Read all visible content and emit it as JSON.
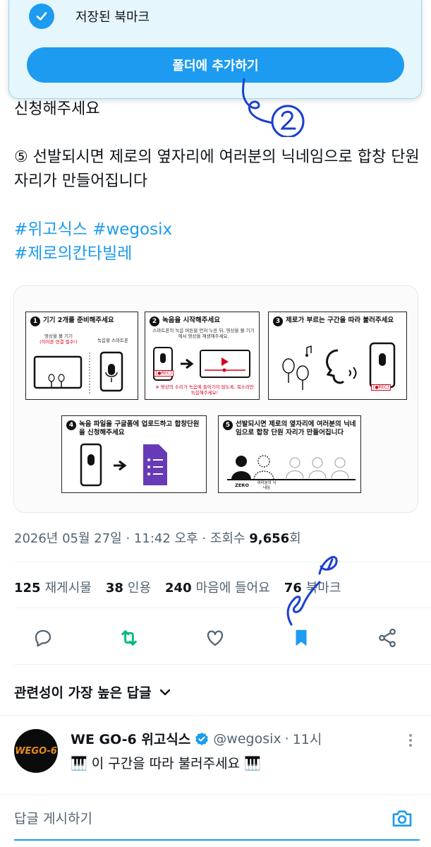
{
  "popup": {
    "saved_label": "저장된 북마크",
    "folder_button": "폴더에 추가하기"
  },
  "tweet": {
    "line_partial": "신청해주세요",
    "step5_text": "⑤ 선발되시면 제로의 옆자리에 여러분의 닉네임으로 합창 단원 자리가 만들어집니다",
    "hashtags": [
      "#위고식스 #wegosix",
      "#제로의칸타빌레"
    ]
  },
  "guide": {
    "steps": [
      {
        "num": "1",
        "title": "기기 2개를 준비해주세요"
      },
      {
        "num": "2",
        "title": "녹음을 시작해주세요"
      },
      {
        "num": "3",
        "title": "제로가 부르는 구간을 따라 불러주세요"
      },
      {
        "num": "4",
        "title": "녹음 파일을 구글폼에 업로드하고 합창단원을 신청해주세요"
      },
      {
        "num": "5",
        "title": "선발되시면 제로의 옆자리에 여러분의 닉네임으로 합창 단원 자리가 만들어집니다"
      }
    ],
    "s1_left": "영상을 볼 기기",
    "s1_left_note": "(이어폰 연결 필수!)",
    "s1_right": "녹음할 스마트폰",
    "s2_desc": "스마트폰의 녹음 버튼을 먼저 누른 뒤, 영상을 볼 기기에서 영상을 재생해주세요.",
    "s2_warn": "※ 영상의 소리가 녹음에 들어가지 않도록, 목소리만 녹음해주세요!",
    "rec": "[●REC]",
    "zero": "ZERO",
    "nickname": "여러분의 닉네임"
  },
  "meta": {
    "date": "2026년 05월 27일",
    "time": "11:42 오후",
    "views_label": "조회수",
    "views": "9,656",
    "views_unit": "회"
  },
  "stats": [
    {
      "count": "125",
      "label": "재게시물"
    },
    {
      "count": "38",
      "label": "인용"
    },
    {
      "count": "240",
      "label": "마음에 들어요"
    },
    {
      "count": "76",
      "label": "북마크"
    }
  ],
  "colors": {
    "accent": "#1d9bf0",
    "retweet": "#00ba7c",
    "muted": "#536471",
    "pen": "#1a3fd1"
  },
  "sort_label": "관련성이 가장 높은 답글",
  "reply": {
    "avatar_text": "WEGO-6",
    "name": "WE GO-6 위고식스",
    "handle": "@wegosix",
    "time": "11시",
    "text": "🎹 이 구간을 따라 불러주세요 🎹"
  },
  "compose": {
    "placeholder": "답글 게시하기"
  }
}
